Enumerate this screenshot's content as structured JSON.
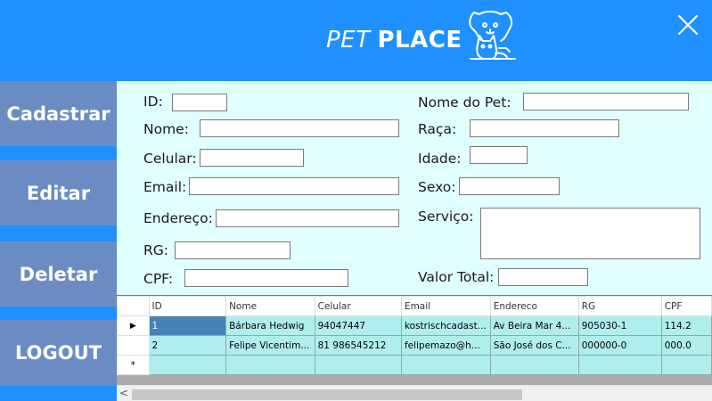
{
  "header": {
    "title_part1": "PET",
    "title_part2": "PLACE",
    "logo_icon": "dog-cat-logo-icon",
    "close_icon": "close-icon",
    "background": "#1E90FF"
  },
  "sidebar": {
    "items": [
      {
        "label": "Cadastrar"
      },
      {
        "label": "Editar"
      },
      {
        "label": "Deletar"
      },
      {
        "label": "LOGOUT"
      }
    ]
  },
  "form": {
    "id_label": "ID:",
    "nome_label": "Nome:",
    "celular_label": "Celular:",
    "email_label": "Email:",
    "endereco_label": "Endereço:",
    "rg_label": "RG:",
    "cpf_label": "CPF:",
    "nome_pet_label": "Nome do Pet:",
    "raca_label": "Raça:",
    "idade_label": "Idade:",
    "sexo_label": "Sexo:",
    "servico_label": "Serviço:",
    "valor_total_label": "Valor Total:"
  },
  "grid": {
    "columns": [
      "ID",
      "Nome",
      "Celular",
      "Email",
      "Endereco",
      "RG",
      "CPF"
    ],
    "rows": [
      {
        "marker": "▶",
        "cells": [
          "1",
          "Bárbara Hedwig",
          "94047447",
          "kostrischcadast...",
          "Av Beira Mar 4...",
          "905030-1",
          "114.2"
        ]
      },
      {
        "marker": "",
        "cells": [
          "2",
          "Felipe Vicentim...",
          "81 986545212",
          "felipemazo@h...",
          "São José dos C...",
          "000000-0",
          "000.0"
        ]
      },
      {
        "marker": "*",
        "cells": [
          "",
          "",
          "",
          "",
          "",
          "",
          ""
        ]
      }
    ],
    "scroll_left_arrow": "<"
  }
}
